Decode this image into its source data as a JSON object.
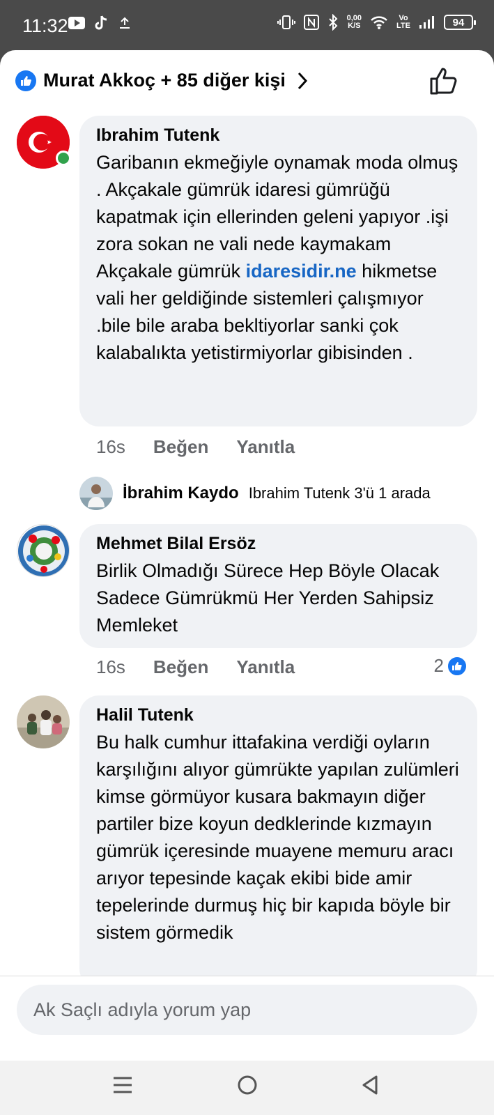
{
  "status": {
    "time": "11:32",
    "net_speed_top": "0,00",
    "net_speed_bottom": "K/S",
    "volte_top": "Vo",
    "volte_bottom": "LTE",
    "battery": "94"
  },
  "header": {
    "likes_text": "Murat Akkoç + 85 diğer kişi"
  },
  "comments": [
    {
      "name": "Ibrahim Tutenk",
      "text_before": "Garibanın ekmeğiyle oynamak moda olmuş . Akçakale gümrük idaresi gümrüğü kapatmak için ellerinden geleni yapıyor .işi zora sokan ne vali nede kaymakam Akçakale gümrük ",
      "link": "idaresidir.ne",
      "text_after": " hikmetse vali her geldiğinde sistemleri çalışmıyor .bile bile araba bekltiyorlar sanki çok kalabalıkta yetistirmiyorlar gibisinden .",
      "time": "16s",
      "like_label": "Beğen",
      "reply_label": "Yanıtla"
    },
    {
      "name": "Mehmet Bilal Ersöz",
      "text": "Birlik Olmadığı Sürece Hep Böyle Olacak Sadece Gümrükmü Her Yerden Sahipsiz Memleket",
      "time": "16s",
      "like_label": "Beğen",
      "reply_label": "Yanıtla",
      "reaction_count": "2"
    },
    {
      "name": "Halil Tutenk",
      "text": "Bu halk cumhur ittafakina verdiği oyların karşılığını alıyor gümrükte yapılan zulümleri kimse görmüyor kusara bakmayın diğer partiler bize koyun dedklerinde kızmayın gümrük içeresinde muayene memuru aracı arıyor tepesinde kaçak ekibi bide amir tepelerinde durmuş hiç bir kapıda böyle bir sistem görmedik"
    }
  ],
  "reply_preview": {
    "name": "İbrahim Kaydo",
    "text": "Ibrahim Tutenk 3'ü 1 arada"
  },
  "composer": {
    "placeholder": "Ak Saçlı adıyla yorum yap"
  },
  "colors": {
    "accent": "#1877f2",
    "bubble": "#f0f2f5",
    "link": "#1766c4"
  }
}
